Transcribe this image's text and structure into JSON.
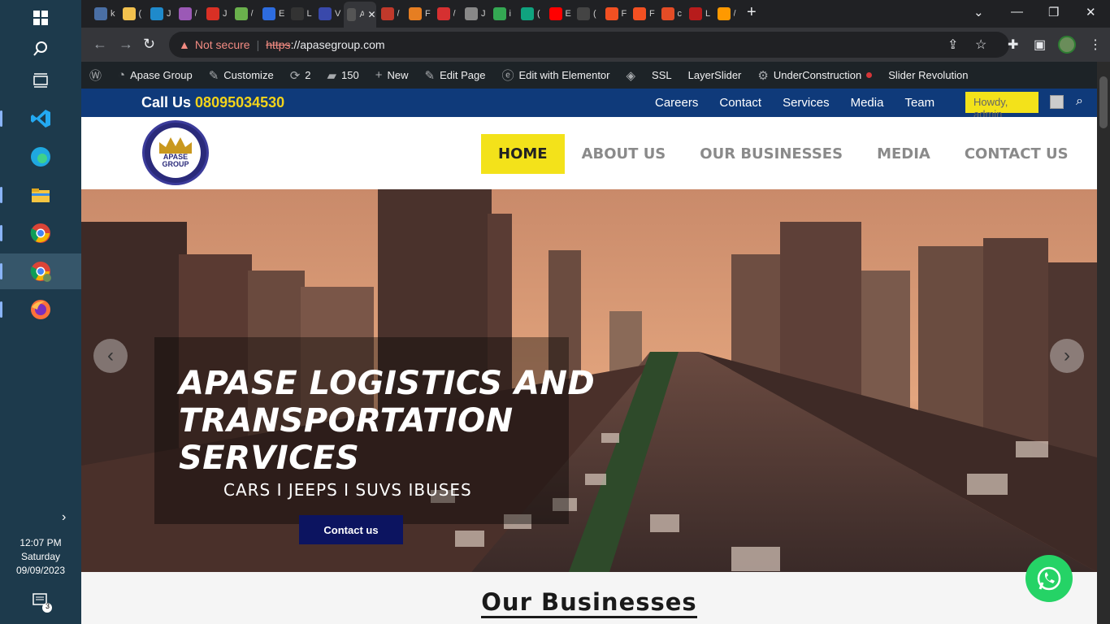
{
  "taskbar": {
    "time": "12:07 PM",
    "day": "Saturday",
    "date": "09/09/2023",
    "notif_count": "3"
  },
  "browser": {
    "tabs": [
      {
        "letter": "k",
        "color": "#4a6fa5"
      },
      {
        "letter": "(",
        "color": "#f2c14e"
      },
      {
        "letter": "J",
        "color": "#1f8acb"
      },
      {
        "letter": "/",
        "color": "#9b59b6"
      },
      {
        "letter": "J",
        "color": "#d93025"
      },
      {
        "letter": "/",
        "color": "#6ab04c"
      },
      {
        "letter": "E",
        "color": "#2d6cdf"
      },
      {
        "letter": "L",
        "color": "#333333"
      },
      {
        "letter": "V",
        "color": "#3949ab"
      },
      {
        "letter": "A",
        "color": "#555555",
        "active": true
      },
      {
        "letter": "/",
        "color": "#c0392b"
      },
      {
        "letter": "F",
        "color": "#e67e22"
      },
      {
        "letter": "/",
        "color": "#d63031"
      },
      {
        "letter": "J",
        "color": "#888888"
      },
      {
        "letter": "i",
        "color": "#34a853"
      },
      {
        "letter": "(",
        "color": "#10a37f"
      },
      {
        "letter": "E",
        "color": "#ff0000"
      },
      {
        "letter": "(",
        "color": "#444444"
      },
      {
        "letter": "F",
        "color": "#f25022"
      },
      {
        "letter": "F",
        "color": "#f25022"
      },
      {
        "letter": "c",
        "color": "#e34c26"
      },
      {
        "letter": "L",
        "color": "#b71c1c"
      },
      {
        "letter": "/",
        "color": "#ff9900"
      }
    ],
    "close_tab": "✕",
    "new_tab": "+",
    "security_label": "Not secure",
    "url_scheme": "https",
    "url_rest": "://apasegroup.com"
  },
  "adminbar": {
    "site": "Apase Group",
    "customize": "Customize",
    "updates": "2",
    "comments": "150",
    "new": "New",
    "edit_page": "Edit Page",
    "elementor": "Edit with Elementor",
    "ssl": "SSL",
    "layerslider": "LayerSlider",
    "underconstruction": "UnderConstruction",
    "slider_rev": "Slider Revolution"
  },
  "topbar": {
    "call_label": "Call Us",
    "phone": "08095034530",
    "links": [
      "Careers",
      "Contact",
      "Services",
      "Media",
      "Team"
    ],
    "howdy": "Howdy, admin"
  },
  "header": {
    "logo_text": "APASE GROUP",
    "nav": [
      "HOME",
      "ABOUT US",
      "OUR BUSINESSES",
      "MEDIA",
      "CONTACT US"
    ]
  },
  "hero": {
    "title": "APASE LOGISTICS AND TRANSPORTATION SERVICES",
    "subtitle": "CARS I JEEPS I SUVS IBUSES",
    "cta": "Contact us"
  },
  "section": {
    "title": "Our Businesses"
  }
}
